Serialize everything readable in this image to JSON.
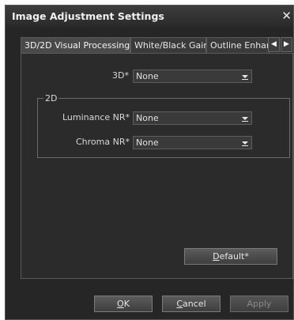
{
  "dialog": {
    "title": "Image Adjustment Settings",
    "close_glyph": "✕"
  },
  "tabs": [
    {
      "label": "3D/2D Visual Processing",
      "active": true
    },
    {
      "label": "White/Black Gain",
      "active": false
    },
    {
      "label": "Outline Enhan",
      "active": false
    }
  ],
  "tab_scroll": {
    "left_icon": "◀",
    "right_icon": "▶"
  },
  "settings": {
    "three_d": {
      "label": "3D*",
      "value": "None"
    },
    "group_2d": {
      "title": "2D",
      "luminance_nr": {
        "label": "Luminance NR*",
        "value": "None"
      },
      "chroma_nr": {
        "label": "Chroma NR*",
        "value": "None"
      }
    }
  },
  "buttons": {
    "default": {
      "mnemonic": "D",
      "rest": "efault*"
    },
    "ok": {
      "mnemonic": "O",
      "rest": "K"
    },
    "cancel": {
      "mnemonic": "C",
      "rest": "ancel"
    },
    "apply": {
      "label": "Apply",
      "enabled": false
    }
  }
}
